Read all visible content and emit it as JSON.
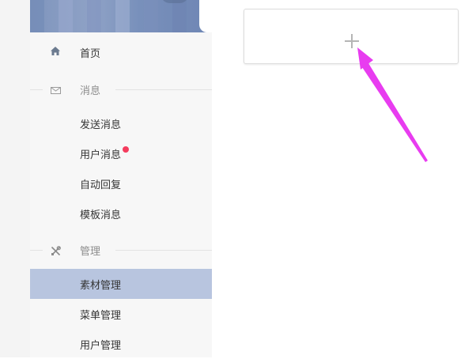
{
  "sidebar": {
    "home": {
      "label": "首页",
      "icon": "home-icon"
    },
    "sections": [
      {
        "title": "消息",
        "icon": "envelope-icon",
        "items": [
          {
            "label": "发送消息",
            "badge": false
          },
          {
            "label": "用户消息",
            "badge": true
          },
          {
            "label": "自动回复",
            "badge": false
          },
          {
            "label": "模板消息",
            "badge": false
          }
        ]
      },
      {
        "title": "管理",
        "icon": "tools-icon",
        "items": [
          {
            "label": "素材管理",
            "active": true
          },
          {
            "label": "菜单管理",
            "active": false
          },
          {
            "label": "用户管理",
            "active": false
          }
        ]
      }
    ]
  },
  "main": {
    "upload_card": {
      "icon": "plus-icon"
    }
  },
  "colors": {
    "active_bg": "#b8c5df",
    "badge": "#f43c5d",
    "annotation_arrow": "#e83cf0"
  }
}
